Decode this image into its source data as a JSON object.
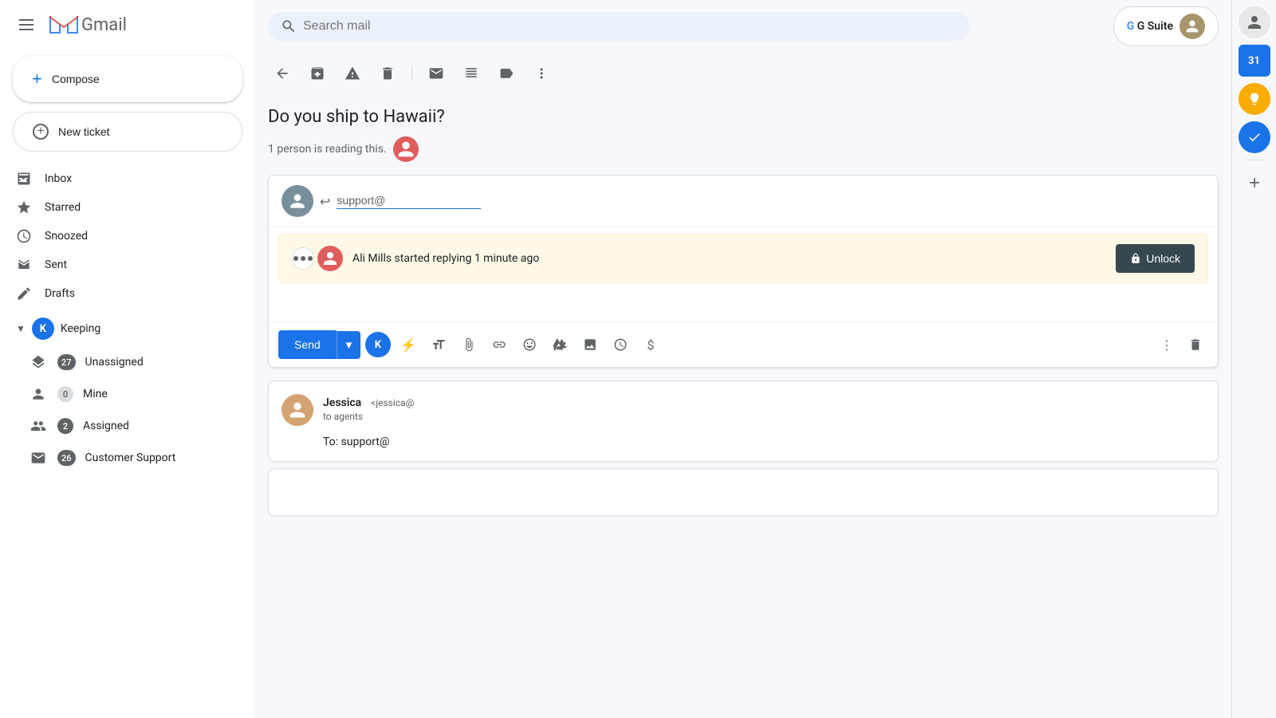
{
  "sidebar": {
    "menu_label": "Menu",
    "logo_m": "M",
    "logo_text": "Gmail",
    "compose_label": "Compose",
    "new_ticket_label": "New ticket",
    "nav_items": [
      {
        "id": "inbox",
        "label": "Inbox",
        "icon": "inbox"
      },
      {
        "id": "starred",
        "label": "Starred",
        "icon": "star"
      },
      {
        "id": "snoozed",
        "label": "Snoozed",
        "icon": "clock"
      },
      {
        "id": "sent",
        "label": "Sent",
        "icon": "send"
      },
      {
        "id": "drafts",
        "label": "Drafts",
        "icon": "draft"
      }
    ],
    "keeping_label": "Keeping",
    "keeping_sub": [
      {
        "id": "unassigned",
        "label": "Unassigned",
        "count": "27",
        "icon": "layers"
      },
      {
        "id": "mine",
        "label": "Mine",
        "count": "0",
        "icon": "person",
        "zero": true
      },
      {
        "id": "assigned",
        "label": "Assigned",
        "count": "2",
        "icon": "people"
      },
      {
        "id": "customer-support",
        "label": "Customer Support",
        "count": "26",
        "icon": "mail"
      }
    ]
  },
  "topbar": {
    "search_placeholder": "Search mail",
    "gsuite_label": "G Suite",
    "gsuite_letters": [
      "G",
      " ",
      "S",
      "u",
      "i",
      "t",
      "e"
    ]
  },
  "toolbar": {
    "back_label": "←",
    "archive_label": "⬇",
    "report_label": "⚠",
    "delete_label": "🗑",
    "mark_unread_label": "✉",
    "move_label": "⬇",
    "label_label": "🏷",
    "more_label": "⋮"
  },
  "email": {
    "subject": "Do you ship to Hawaii?",
    "reading_count_text": "1 person is reading this.",
    "reply_to": "support@",
    "typing_banner": {
      "text": "Ali Mills started replying 1 minute ago",
      "unlock_label": "Unlock"
    },
    "send_label": "Send",
    "sender": {
      "name": "Jessica",
      "email": "<jessica@",
      "to": "to agents",
      "body_to": "To: support@"
    }
  },
  "right_sidebar": {
    "calendar_label": "31",
    "bulb_icon": "💡",
    "check_icon": "✓",
    "add_icon": "+"
  }
}
